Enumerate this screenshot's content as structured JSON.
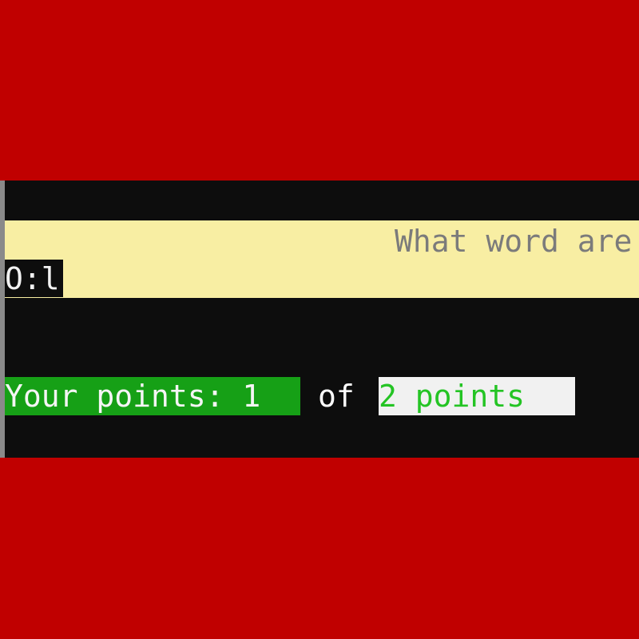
{
  "prompt": {
    "question_text": "What word are",
    "counter": "O:l"
  },
  "score": {
    "your_points": "Your points: 1",
    "of_label": "of",
    "total_points": "2 points"
  },
  "colors": {
    "background": "#c00000",
    "terminal": "#0d0d0d",
    "question_bar": "#f8eea3",
    "points_bar": "#16a016",
    "total_text": "#24c424"
  }
}
